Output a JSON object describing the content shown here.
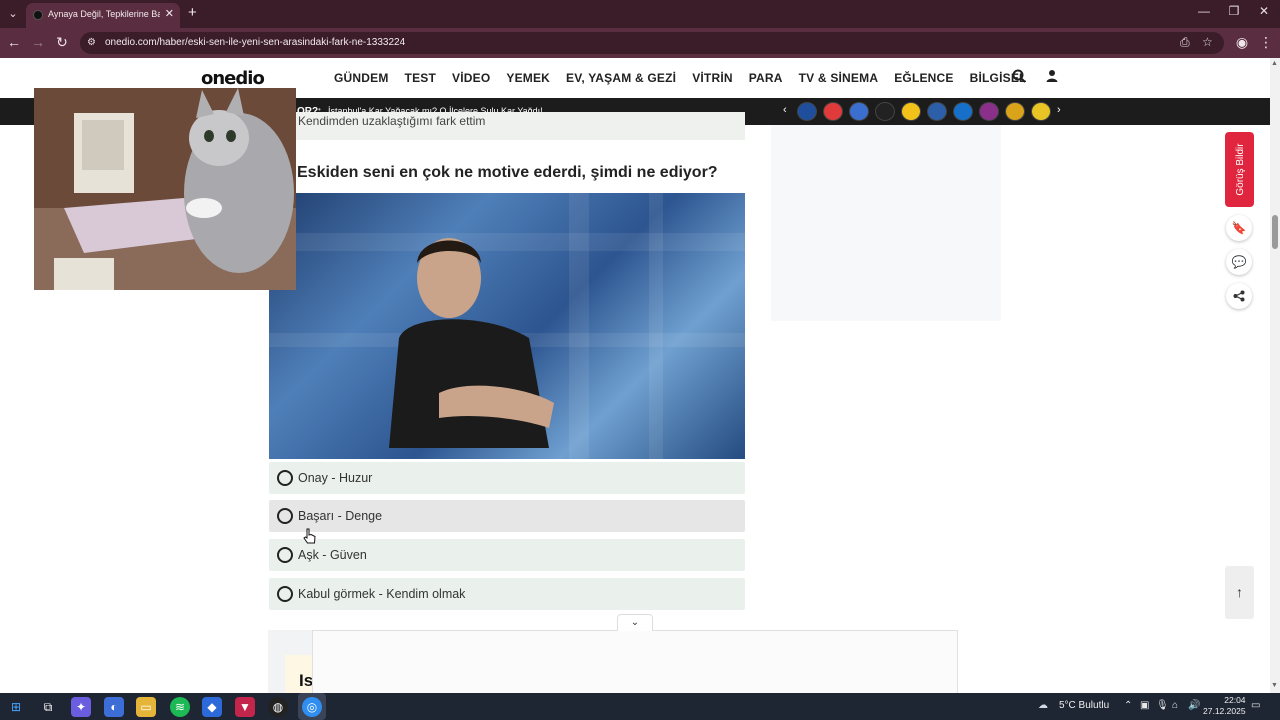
{
  "browser": {
    "tab_title": "Aynaya Değil, Tepkilerine Bakın...",
    "new_tab": "+",
    "url": "onedio.com/haber/eski-sen-ile-yeni-sen-arasindaki-fark-ne-1333224",
    "icons": {
      "tab_list": "chevron-down-icon",
      "back": "arrow-left-icon",
      "forward": "arrow-right-icon",
      "reload": "reload-icon",
      "site_info": "site-info-icon",
      "install": "install-app-icon",
      "bookmark": "star-icon",
      "profile": "profile-icon",
      "menu": "kebab-menu-icon"
    }
  },
  "site": {
    "logo": "onedio",
    "menu": [
      "GÜNDEM",
      "TEST",
      "VİDEO",
      "YEMEK",
      "EV, YAŞAM & GEZİ",
      "VİTRİN",
      "PARA",
      "TV & SİNEMA",
      "EĞLENCE",
      "BİLGİSEL"
    ],
    "icons": {
      "search": "search-icon",
      "user": "user-icon"
    }
  },
  "ticker": {
    "label": "OR?",
    "headline": "İstanbul'a Kar Yağacak mı? O İlçelere Sulu Kar Yağdı!",
    "logo_colors": [
      "#1f4e9c",
      "#e03a3a",
      "#3a6fd0",
      "#222222",
      "#f2c21b",
      "#2c5fa8",
      "#1670c9",
      "#8a2f8a",
      "#d9a31a",
      "#e8c424"
    ]
  },
  "content": {
    "prev_answer": "Kendimden uzaklaştığımı fark ettim",
    "question": "Eskiden seni en çok ne motive ederdi, şimdi ne ediyor?",
    "options": [
      {
        "label": "Onay - Huzur"
      },
      {
        "label": "Başarı - Denge"
      },
      {
        "label": "Aşk - Güven"
      },
      {
        "label": "Kabul görmek - Kendim olmak"
      }
    ],
    "peek_text": "Is"
  },
  "rail": {
    "feedback": "Görüş Bildir",
    "icons": [
      "bookmark-icon",
      "comments-icon",
      "share-icon"
    ],
    "back_to_top": "arrow-up-icon"
  },
  "taskbar": {
    "weather": "5°C  Bulutlu",
    "time": "22:04",
    "date": "27.12.2025"
  },
  "colors": {
    "chrome_dark": "#3b1d2a",
    "chrome_mid": "#5a2e40",
    "accent_red": "#e0263e",
    "option_bg": "#eaf1ed",
    "ticker_bg": "#1c1c1c"
  }
}
